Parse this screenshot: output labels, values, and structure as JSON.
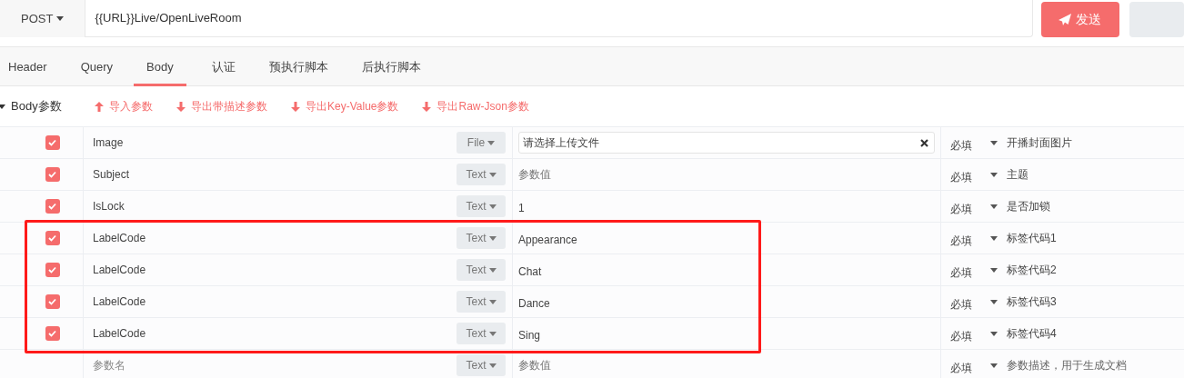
{
  "request": {
    "method": "POST",
    "url": "{{URL}}Live/OpenLiveRoom",
    "send_label": "发送"
  },
  "tabs": [
    {
      "label": "Header",
      "selected": false
    },
    {
      "label": "Query",
      "selected": false
    },
    {
      "label": "Body",
      "selected": true
    },
    {
      "label": "认证",
      "selected": false
    },
    {
      "label": "预执行脚本",
      "selected": false
    },
    {
      "label": "后执行脚本",
      "selected": false
    }
  ],
  "body_toolbar": {
    "title": "Body参数",
    "actions": [
      {
        "label": "导入参数",
        "kind": "up"
      },
      {
        "label": "导出带描述参数",
        "kind": "down"
      },
      {
        "label": "导出Key-Value参数",
        "kind": "down"
      },
      {
        "label": "导出Raw-Json参数",
        "kind": "down"
      }
    ]
  },
  "params": [
    {
      "checked": true,
      "name": "Image",
      "type": "File",
      "kind": "file",
      "value_placeholder": "请选择上传文件",
      "required": "必填",
      "description": "开播封面图片"
    },
    {
      "checked": true,
      "name": "Subject",
      "type": "Text",
      "kind": "text",
      "value_placeholder": "参数值",
      "required": "必填",
      "description": "主题"
    },
    {
      "checked": true,
      "name": "IsLock",
      "type": "Text",
      "kind": "text",
      "value": "1",
      "required": "必填",
      "description": "是否加锁"
    }
  ],
  "highlighted_params": [
    {
      "checked": true,
      "name": "LabelCode",
      "type": "Text",
      "kind": "text",
      "value": "Appearance",
      "required": "必填",
      "description": "标签代码1"
    },
    {
      "checked": true,
      "name": "LabelCode",
      "type": "Text",
      "kind": "text",
      "value": "Chat",
      "required": "必填",
      "description": "标签代码2"
    },
    {
      "checked": true,
      "name": "LabelCode",
      "type": "Text",
      "kind": "text",
      "value": "Dance",
      "required": "必填",
      "description": "标签代码3"
    },
    {
      "checked": true,
      "name": "LabelCode",
      "type": "Text",
      "kind": "text",
      "value": "Sing",
      "required": "必填",
      "description": "标签代码4"
    }
  ],
  "new_param": {
    "kind": "new",
    "name_placeholder": "参数名",
    "type": "Text",
    "value_placeholder": "参数值",
    "required": "必填",
    "description_placeholder": "参数描述，用于生成文档"
  }
}
